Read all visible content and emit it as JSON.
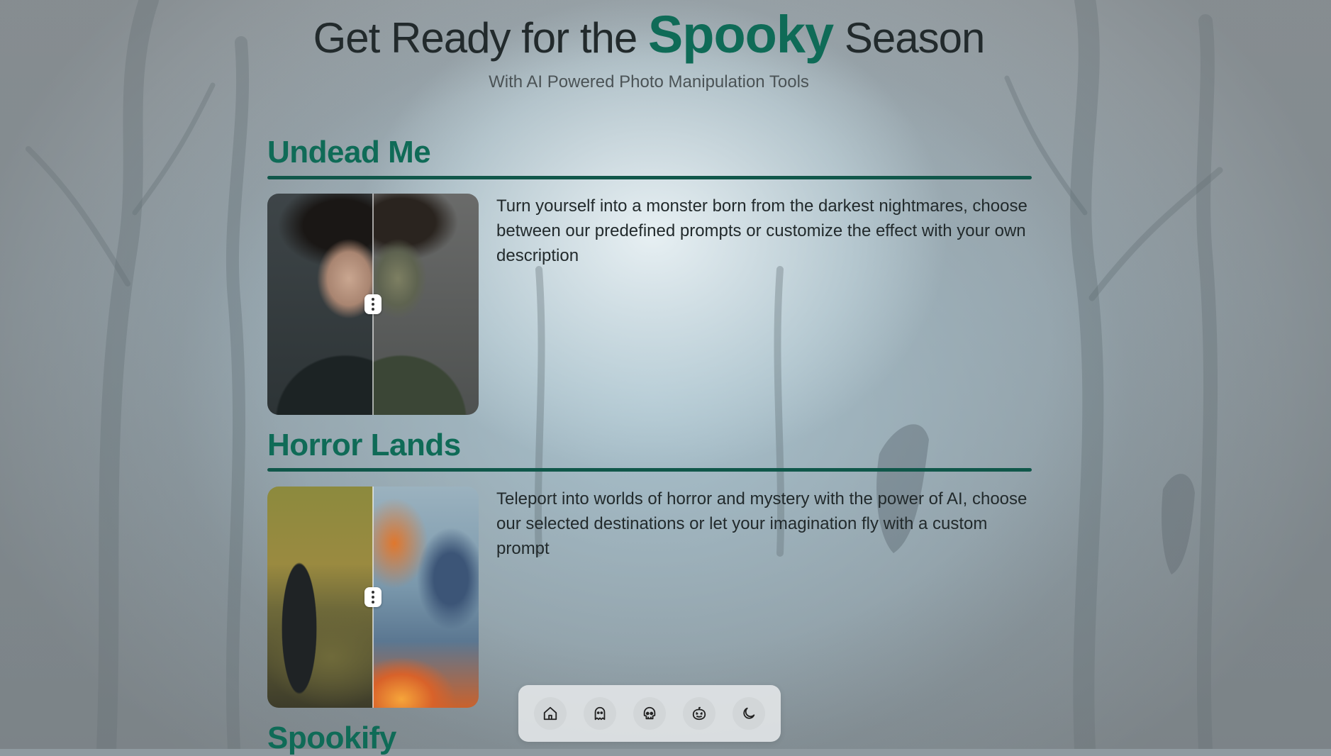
{
  "hero": {
    "title_before": "Get Ready for the ",
    "title_accent": "Spooky",
    "title_after": " Season",
    "subtitle": "With AI Powered Photo Manipulation Tools"
  },
  "sections": [
    {
      "title": "Undead Me",
      "description": "Turn yourself into a monster born from the darkest nightmares, choose between our predefined prompts or customize the effect with your own description"
    },
    {
      "title": "Horror Lands",
      "description": "Teleport into worlds of horror and mystery with the power of AI, choose our selected destinations or let your imagination fly with a custom prompt"
    },
    {
      "title": "Spookify"
    }
  ],
  "dock": {
    "items": [
      {
        "icon": "home-icon"
      },
      {
        "icon": "ghost-icon"
      },
      {
        "icon": "skull-icon"
      },
      {
        "icon": "pumpkin-icon"
      },
      {
        "icon": "moon-icon"
      }
    ]
  },
  "colors": {
    "accent": "#0f6b57",
    "divider": "#10574a",
    "text": "#222a2c",
    "dock_bg": "#e1e4e6"
  }
}
